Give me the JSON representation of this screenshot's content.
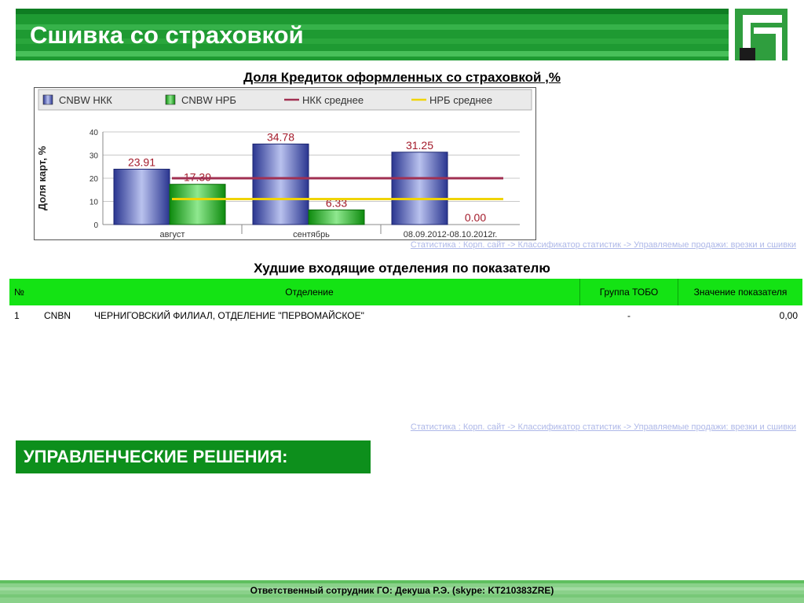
{
  "header": {
    "title": "Сшивка со страховкой"
  },
  "chart_title": "Доля Кредиток оформленных со страховкой ,%",
  "chart_data": {
    "type": "bar",
    "categories": [
      "август",
      "сентябрь",
      "08.09.2012-08.10.2012г."
    ],
    "series": [
      {
        "name": "CNBW НКК",
        "values": [
          23.91,
          34.78,
          31.25
        ],
        "color": "#3a4aa8"
      },
      {
        "name": "CNBW НРБ",
        "values": [
          17.39,
          6.33,
          0.0
        ],
        "color": "#17a617"
      }
    ],
    "lines": [
      {
        "name": "НКК среднее",
        "value": 20,
        "color": "#a13052"
      },
      {
        "name": "НРБ среднее",
        "value": 11,
        "color": "#f0d400"
      }
    ],
    "data_labels": [
      [
        "23.91",
        "17.39"
      ],
      [
        "34.78",
        "6.33"
      ],
      [
        "31.25",
        "0.00"
      ]
    ],
    "ylabel": "Доля карт, %",
    "ylim": [
      0,
      40
    ],
    "yticks": [
      "0",
      "10",
      "20",
      "30",
      "40"
    ],
    "grid": true,
    "legend": "top"
  },
  "source_link": "Статистика : Корп. сайт -> Классификатор статистик -> Управляемые продажи: врезки и сшивки",
  "worst_table": {
    "title": "Худшие входящие отделения по показателю",
    "headers": [
      "№",
      "Отделение",
      "Группа ТОБО",
      "Значение показателя"
    ],
    "rows": [
      {
        "num": "1",
        "code": "CNBN",
        "branch": "ЧЕРНИГОВСКИЙ ФИЛИАЛ, ОТДЕЛЕНИЕ \"ПЕРВОМАЙСКОЕ\"",
        "group": "-",
        "value": "0,00"
      }
    ]
  },
  "decisions_title": "УПРАВЛЕНЧЕСКИЕ РЕШЕНИЯ:",
  "footer": {
    "text": "Ответственный сотрудник ГО: Декуша Р.Э. (skype: KT210383ZRE)"
  }
}
